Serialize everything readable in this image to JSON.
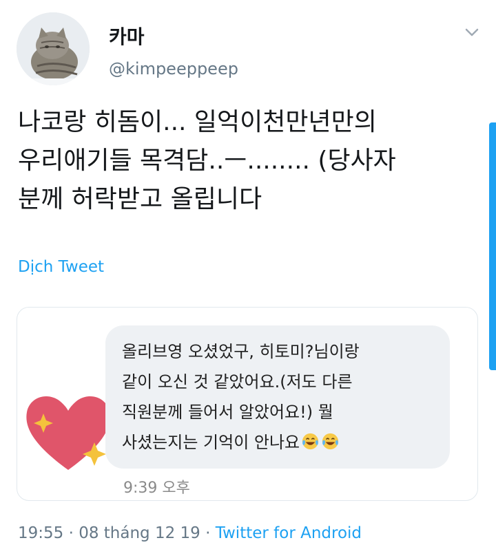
{
  "author": {
    "display_name": "카마",
    "handle": "@kimpeeppeep"
  },
  "tweet": {
    "lines": [
      "나코랑 히돔이... 일억이천만년만의",
      "우리애기들 목격담..ㅡ........ (당사자",
      "분께 허락받고 올립니다"
    ],
    "translate_label": "Dịch Tweet"
  },
  "embedded_message": {
    "lines": [
      "올리브영 오셨었구, 히토미?님이랑",
      "같이 오신 것 같았어요.(저도 다른",
      "직원분께 들어서 알았어요!) 뭘",
      "사셨는지는 기억이 안나요"
    ],
    "emojis": [
      "laughing-tears-emoji",
      "laughing-tears-emoji"
    ],
    "time": "9:39 오후"
  },
  "footer": {
    "timestamp": "19:55 · 08 tháng 12 19 · ",
    "app": "Twitter for Android"
  },
  "icons": {
    "avatar": "cat-avatar",
    "menu": "chevron-down-icon",
    "sticker": "sparkling-heart-icon"
  },
  "colors": {
    "accent": "#1da1f2",
    "text": "#14171a",
    "secondary": "#657786",
    "bubble": "#eef1f4",
    "heart": "#e0556a"
  }
}
